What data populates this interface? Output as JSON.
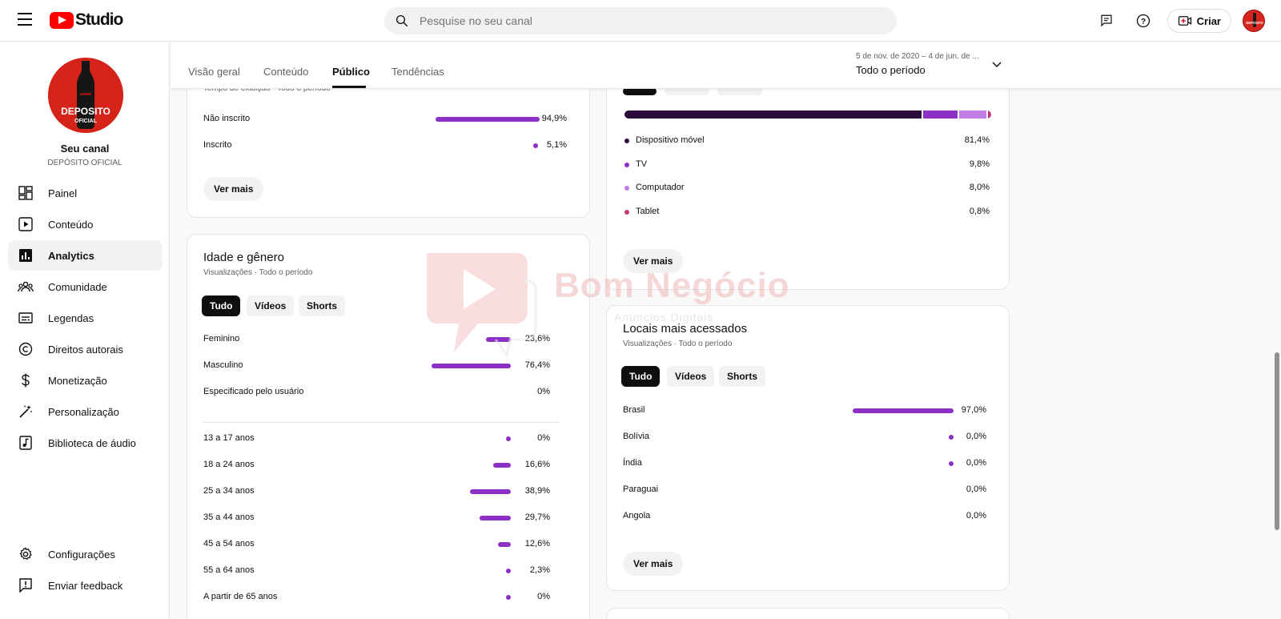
{
  "app": {
    "name": "Studio"
  },
  "search": {
    "placeholder": "Pesquise no seu canal"
  },
  "header": {
    "create_label": "Criar"
  },
  "channel": {
    "logo_text_1": "DEPOSITO",
    "logo_text_2": "OFICIAL",
    "title": "Seu canal",
    "name": "DEPÓSITO OFICIAL"
  },
  "sidebar": {
    "items": [
      {
        "label": "Painel",
        "icon": "dashboard-icon"
      },
      {
        "label": "Conteúdo",
        "icon": "content-icon"
      },
      {
        "label": "Analytics",
        "icon": "analytics-icon",
        "active": true
      },
      {
        "label": "Comunidade",
        "icon": "community-icon"
      },
      {
        "label": "Legendas",
        "icon": "subtitles-icon"
      },
      {
        "label": "Direitos autorais",
        "icon": "copyright-icon"
      },
      {
        "label": "Monetização",
        "icon": "monetization-icon"
      },
      {
        "label": "Personalização",
        "icon": "customization-icon"
      },
      {
        "label": "Biblioteca de áudio",
        "icon": "audio-library-icon"
      }
    ],
    "settings_label": "Configurações",
    "feedback_label": "Enviar feedback"
  },
  "tabs": [
    {
      "label": "Visão geral"
    },
    {
      "label": "Conteúdo"
    },
    {
      "label": "Público",
      "active": true
    },
    {
      "label": "Tendências"
    }
  ],
  "date_range": {
    "range": "5 de nov. de 2020 – 4 de jun. de ...",
    "label": "Todo o período"
  },
  "subscription_card": {
    "subtitle_cut": "Tempo de exibição · Todo o período",
    "rows": [
      {
        "label": "Não inscrito",
        "value": "94,9%",
        "pct": 94.9
      },
      {
        "label": "Inscrito",
        "value": "5,1%",
        "pct": 5.1
      }
    ],
    "more_label": "Ver mais"
  },
  "age_gender_card": {
    "title": "Idade e gênero",
    "subtitle": "Visualizações · Todo o período",
    "chips": [
      "Tudo",
      "Vídeos",
      "Shorts"
    ],
    "gender_rows": [
      {
        "label": "Feminino",
        "value": "23,6%",
        "pct": 23.6
      },
      {
        "label": "Masculino",
        "value": "76,4%",
        "pct": 76.4
      },
      {
        "label": "Especificado pelo usuário",
        "value": "0%",
        "pct": 0
      }
    ],
    "age_rows": [
      {
        "label": "13 a 17 anos",
        "value": "0%",
        "pct": 0
      },
      {
        "label": "18 a 24 anos",
        "value": "16,6%",
        "pct": 16.6
      },
      {
        "label": "25 a 34 anos",
        "value": "38,9%",
        "pct": 38.9
      },
      {
        "label": "35 a 44 anos",
        "value": "29,7%",
        "pct": 29.7
      },
      {
        "label": "45 a 54 anos",
        "value": "12,6%",
        "pct": 12.6
      },
      {
        "label": "55 a 64 anos",
        "value": "2,3%",
        "pct": 2.3
      },
      {
        "label": "A partir de 65 anos",
        "value": "0%",
        "pct": 0
      }
    ]
  },
  "device_card": {
    "rows": [
      {
        "label": "Dispositivo móvel",
        "value": "81,4%",
        "pct": 81.4,
        "color": "#2b0a3d"
      },
      {
        "label": "TV",
        "value": "9,8%",
        "pct": 9.8,
        "color": "#8d31c6"
      },
      {
        "label": "Computador",
        "value": "8,0%",
        "pct": 8.0,
        "color": "#c27ce6"
      },
      {
        "label": "Tablet",
        "value": "0,8%",
        "pct": 0.8,
        "color": "#c6377a"
      }
    ],
    "more_label": "Ver mais"
  },
  "locations_card": {
    "title": "Locais mais acessados",
    "subtitle": "Visualizações · Todo o período",
    "chips": [
      "Tudo",
      "Vídeos",
      "Shorts"
    ],
    "rows": [
      {
        "label": "Brasil",
        "value": "97,0%",
        "pct": 97.0
      },
      {
        "label": "Bolívia",
        "value": "0,0%",
        "pct": 0.01
      },
      {
        "label": "Índia",
        "value": "0,0%",
        "pct": 0.01
      },
      {
        "label": "Paraguai",
        "value": "0,0%",
        "pct": 0
      },
      {
        "label": "Angola",
        "value": "0,0%",
        "pct": 0
      }
    ],
    "more_label": "Ver mais"
  },
  "watermark": {
    "line1": "Bom Negócio",
    "line2": "Anúncios Digitais"
  },
  "colors": {
    "accent": "#8d31c6",
    "brand": "#ff0000"
  }
}
